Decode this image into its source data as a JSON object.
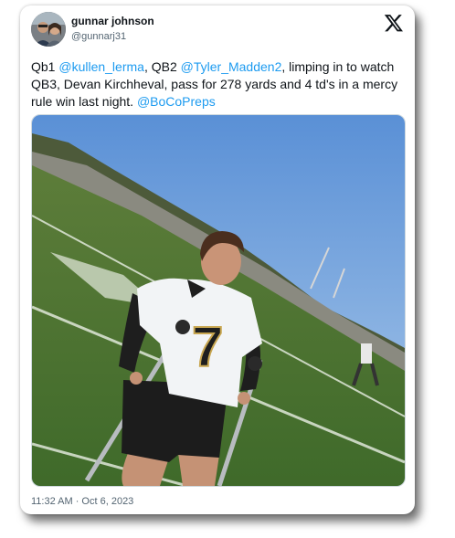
{
  "author": {
    "name": "gunnar johnson",
    "handle": "@gunnarj31"
  },
  "icons": {
    "platform": "x-logo-icon",
    "avatar": "profile-photo"
  },
  "tweet": {
    "t1": "Qb1 ",
    "m1": "@kullen_lerma",
    "t2": ", QB2 ",
    "m2": "@Tyler_Madden2",
    "t3": ", limping in to watch QB3, Devan Kirchheval, pass for 278 yards and 4 td's in a mercy rule win last night.  ",
    "m3": "@BoCoPreps"
  },
  "photo": {
    "jersey_number": "7"
  },
  "timestamp": "11:32 AM · Oct 6, 2023",
  "colors": {
    "mention": "#1d9bf0",
    "text": "#0f1419",
    "muted": "#536471"
  }
}
